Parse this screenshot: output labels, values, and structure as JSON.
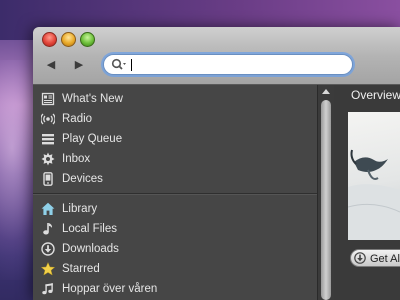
{
  "search": {
    "placeholder": "",
    "value": ""
  },
  "nav": {
    "back": "◀",
    "forward": "▶"
  },
  "sidebar": {
    "items": [
      {
        "label": "What's New",
        "icon": "whats-new-icon"
      },
      {
        "label": "Radio",
        "icon": "radio-icon"
      },
      {
        "label": "Play Queue",
        "icon": "play-queue-icon"
      },
      {
        "label": "Inbox",
        "icon": "inbox-icon"
      },
      {
        "label": "Devices",
        "icon": "devices-icon"
      },
      {
        "label": "Library",
        "icon": "library-icon"
      },
      {
        "label": "Local Files",
        "icon": "local-files-icon"
      },
      {
        "label": "Downloads",
        "icon": "downloads-icon"
      },
      {
        "label": "Starred",
        "icon": "star-icon"
      },
      {
        "label": "Hoppar över våren",
        "icon": "music-note-icon"
      }
    ]
  },
  "main": {
    "section_title": "Overview",
    "get_all_label": "Get All"
  },
  "colors": {
    "sidebar_bg": "#464646",
    "titlebar": "#b4b4b4",
    "search_focus": "#6ea0e6",
    "star": "#f2d04a",
    "library": "#8fd0e8"
  }
}
